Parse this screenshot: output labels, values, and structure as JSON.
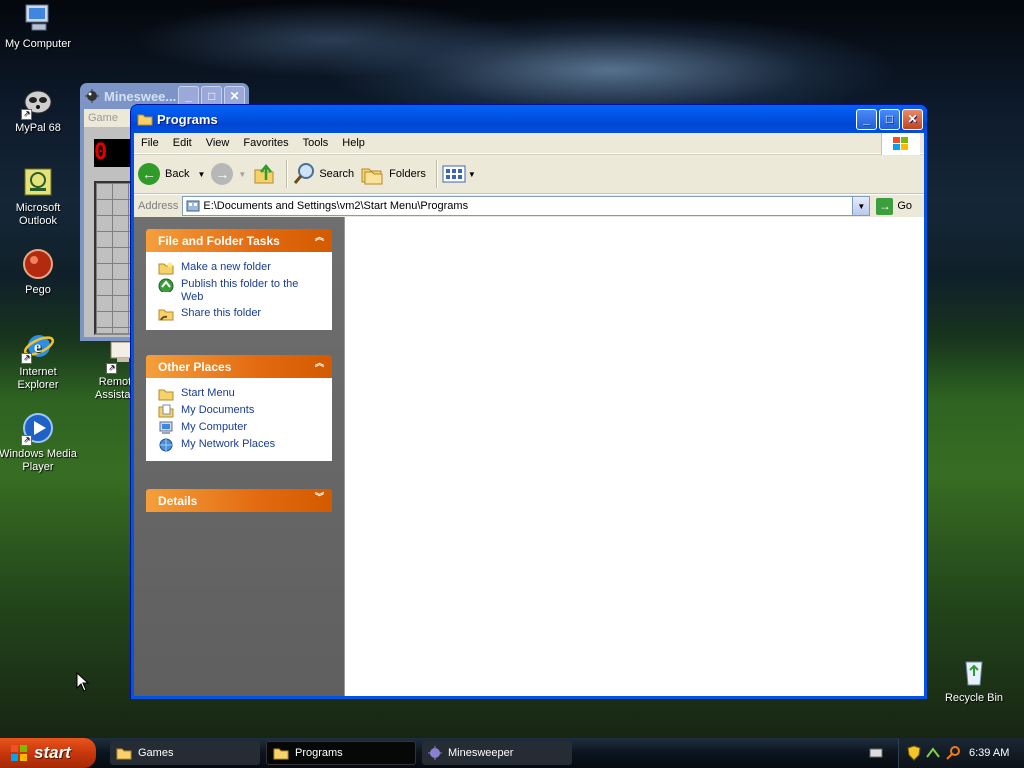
{
  "desktop": {
    "icons": [
      {
        "label": "My Computer"
      },
      {
        "label": "MyPal 68"
      },
      {
        "label": "Microsoft Outlook"
      },
      {
        "label": "Pego"
      },
      {
        "label": "Internet Explorer"
      },
      {
        "label": "Remot Assistan"
      },
      {
        "label": "Windows Media Player"
      },
      {
        "label": "Recycle Bin"
      }
    ]
  },
  "minesweeper": {
    "title": "Minesweе...",
    "menu": "Game",
    "counter": "0"
  },
  "explorer": {
    "title": "Programs",
    "menu": [
      "File",
      "Edit",
      "View",
      "Favorites",
      "Tools",
      "Help"
    ],
    "toolbar": {
      "back": "Back",
      "search": "Search",
      "folders": "Folders"
    },
    "address": {
      "label": "Address",
      "value": "E:\\Documents and Settings\\vm2\\Start Menu\\Programs",
      "go": "Go"
    },
    "tasks": {
      "title": "File and Folder Tasks",
      "items": [
        "Make a new folder",
        "Publish this folder to the Web",
        "Share this folder"
      ]
    },
    "places": {
      "title": "Other Places",
      "items": [
        "Start Menu",
        "My Documents",
        "My Computer",
        "My Network Places"
      ]
    },
    "details": {
      "title": "Details"
    }
  },
  "taskbar": {
    "start": "start",
    "tasks": [
      {
        "label": "Games"
      },
      {
        "label": "Programs"
      },
      {
        "label": "Minesweeper"
      }
    ],
    "clock": "6:39 AM"
  },
  "colors": {
    "xp_blue": "#0054e3",
    "task_orange": "#e36a10",
    "start_green": "#c9370e"
  }
}
